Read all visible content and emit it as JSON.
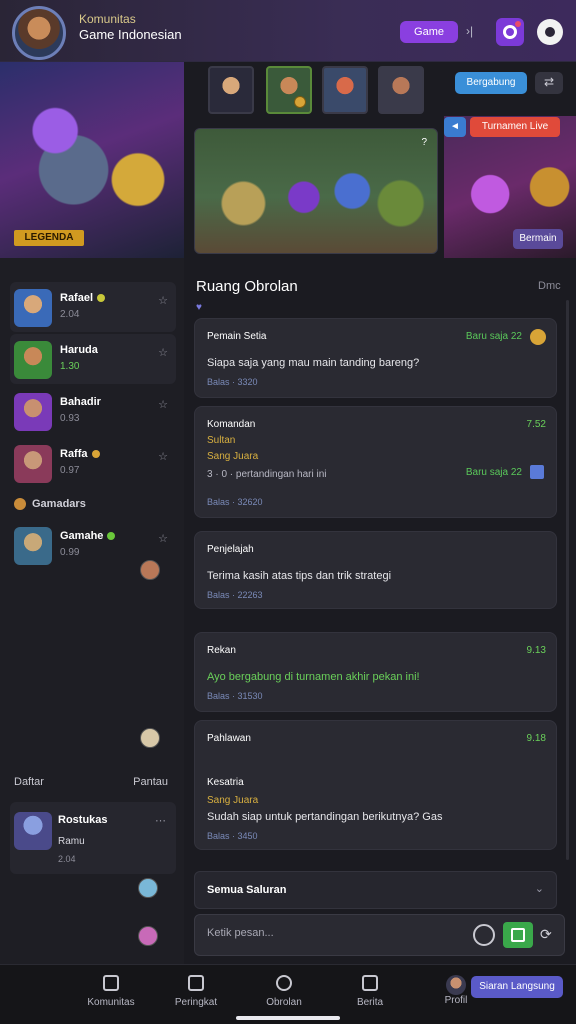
{
  "header": {
    "subtitle": "Komunitas",
    "title": "Game Indonesian",
    "pill_label": "Game",
    "pill_arrow": "›|"
  },
  "hero": {
    "badge": "LEGENDA"
  },
  "top_row": {
    "blue_button": "Bergabung",
    "dark_button": "⇄"
  },
  "banner": {
    "tag": "?",
    "blue_badge": "◄",
    "red_badge": "Turnamen Live",
    "purple_button": "Bermain"
  },
  "sidebar": {
    "items": [
      {
        "name": "Rafael",
        "sub": "2.04"
      },
      {
        "name": "Haruda",
        "sub": "1.30"
      },
      {
        "name": "Bahadir",
        "sub": "0.93"
      },
      {
        "name": "Raffa",
        "sub": "0.97"
      }
    ],
    "section_title": "Gamadars",
    "extra_item": {
      "name": "Gamahe",
      "sub": "0.99"
    },
    "footer_left": "Daftar",
    "footer_right": "Pantau",
    "card": {
      "name": "Rostukas",
      "sub": "Ramu",
      "sub2": "2.04"
    }
  },
  "chat": {
    "title": "Ruang Obrolan",
    "header_right": "Dmc",
    "messages": [
      {
        "who": "Pemain Setia",
        "time": "Baru saja 22",
        "text": "Siapa saja yang mau main tanding bareng?",
        "meta": "Balas · 3320"
      },
      {
        "who": "Komandan",
        "gold1": "Sultan",
        "gold2": "Sang Juara",
        "dim": "3 · 0 · pertandingan hari ini",
        "time": "Baru saja 22",
        "tr": "7.52",
        "meta": "Balas · 32620"
      },
      {
        "who": "Penjelajah",
        "text": "Terima kasih atas tips dan trik strategi",
        "meta": "Balas · 22263"
      },
      {
        "who": "Rekan",
        "text": "Ayo bergabung di turnamen akhir pekan ini!",
        "tr": "9.13",
        "meta": "Balas · 31530"
      },
      {
        "who": "Pahlawan",
        "tr": "9.18",
        "name2": "Kesatria",
        "gold1": "Sang Juara",
        "text": "Sudah siap untuk pertandingan berikutnya? Gas",
        "meta": "Balas · 3450"
      }
    ],
    "dropdown_label": "Semua Saluran",
    "composer_placeholder": "Ketik pesan..."
  },
  "bottom_nav": {
    "items": [
      "Komunitas",
      "Peringkat",
      "Obrolan",
      "Berita",
      "Profil"
    ],
    "cta": "Siaran Langsung"
  },
  "colors": {
    "accent_purple": "#8a3fe0",
    "accent_blue": "#3a8fd8",
    "accent_red": "#e04a3a",
    "accent_green": "#3aa84a",
    "time_green": "#5ac85a"
  }
}
